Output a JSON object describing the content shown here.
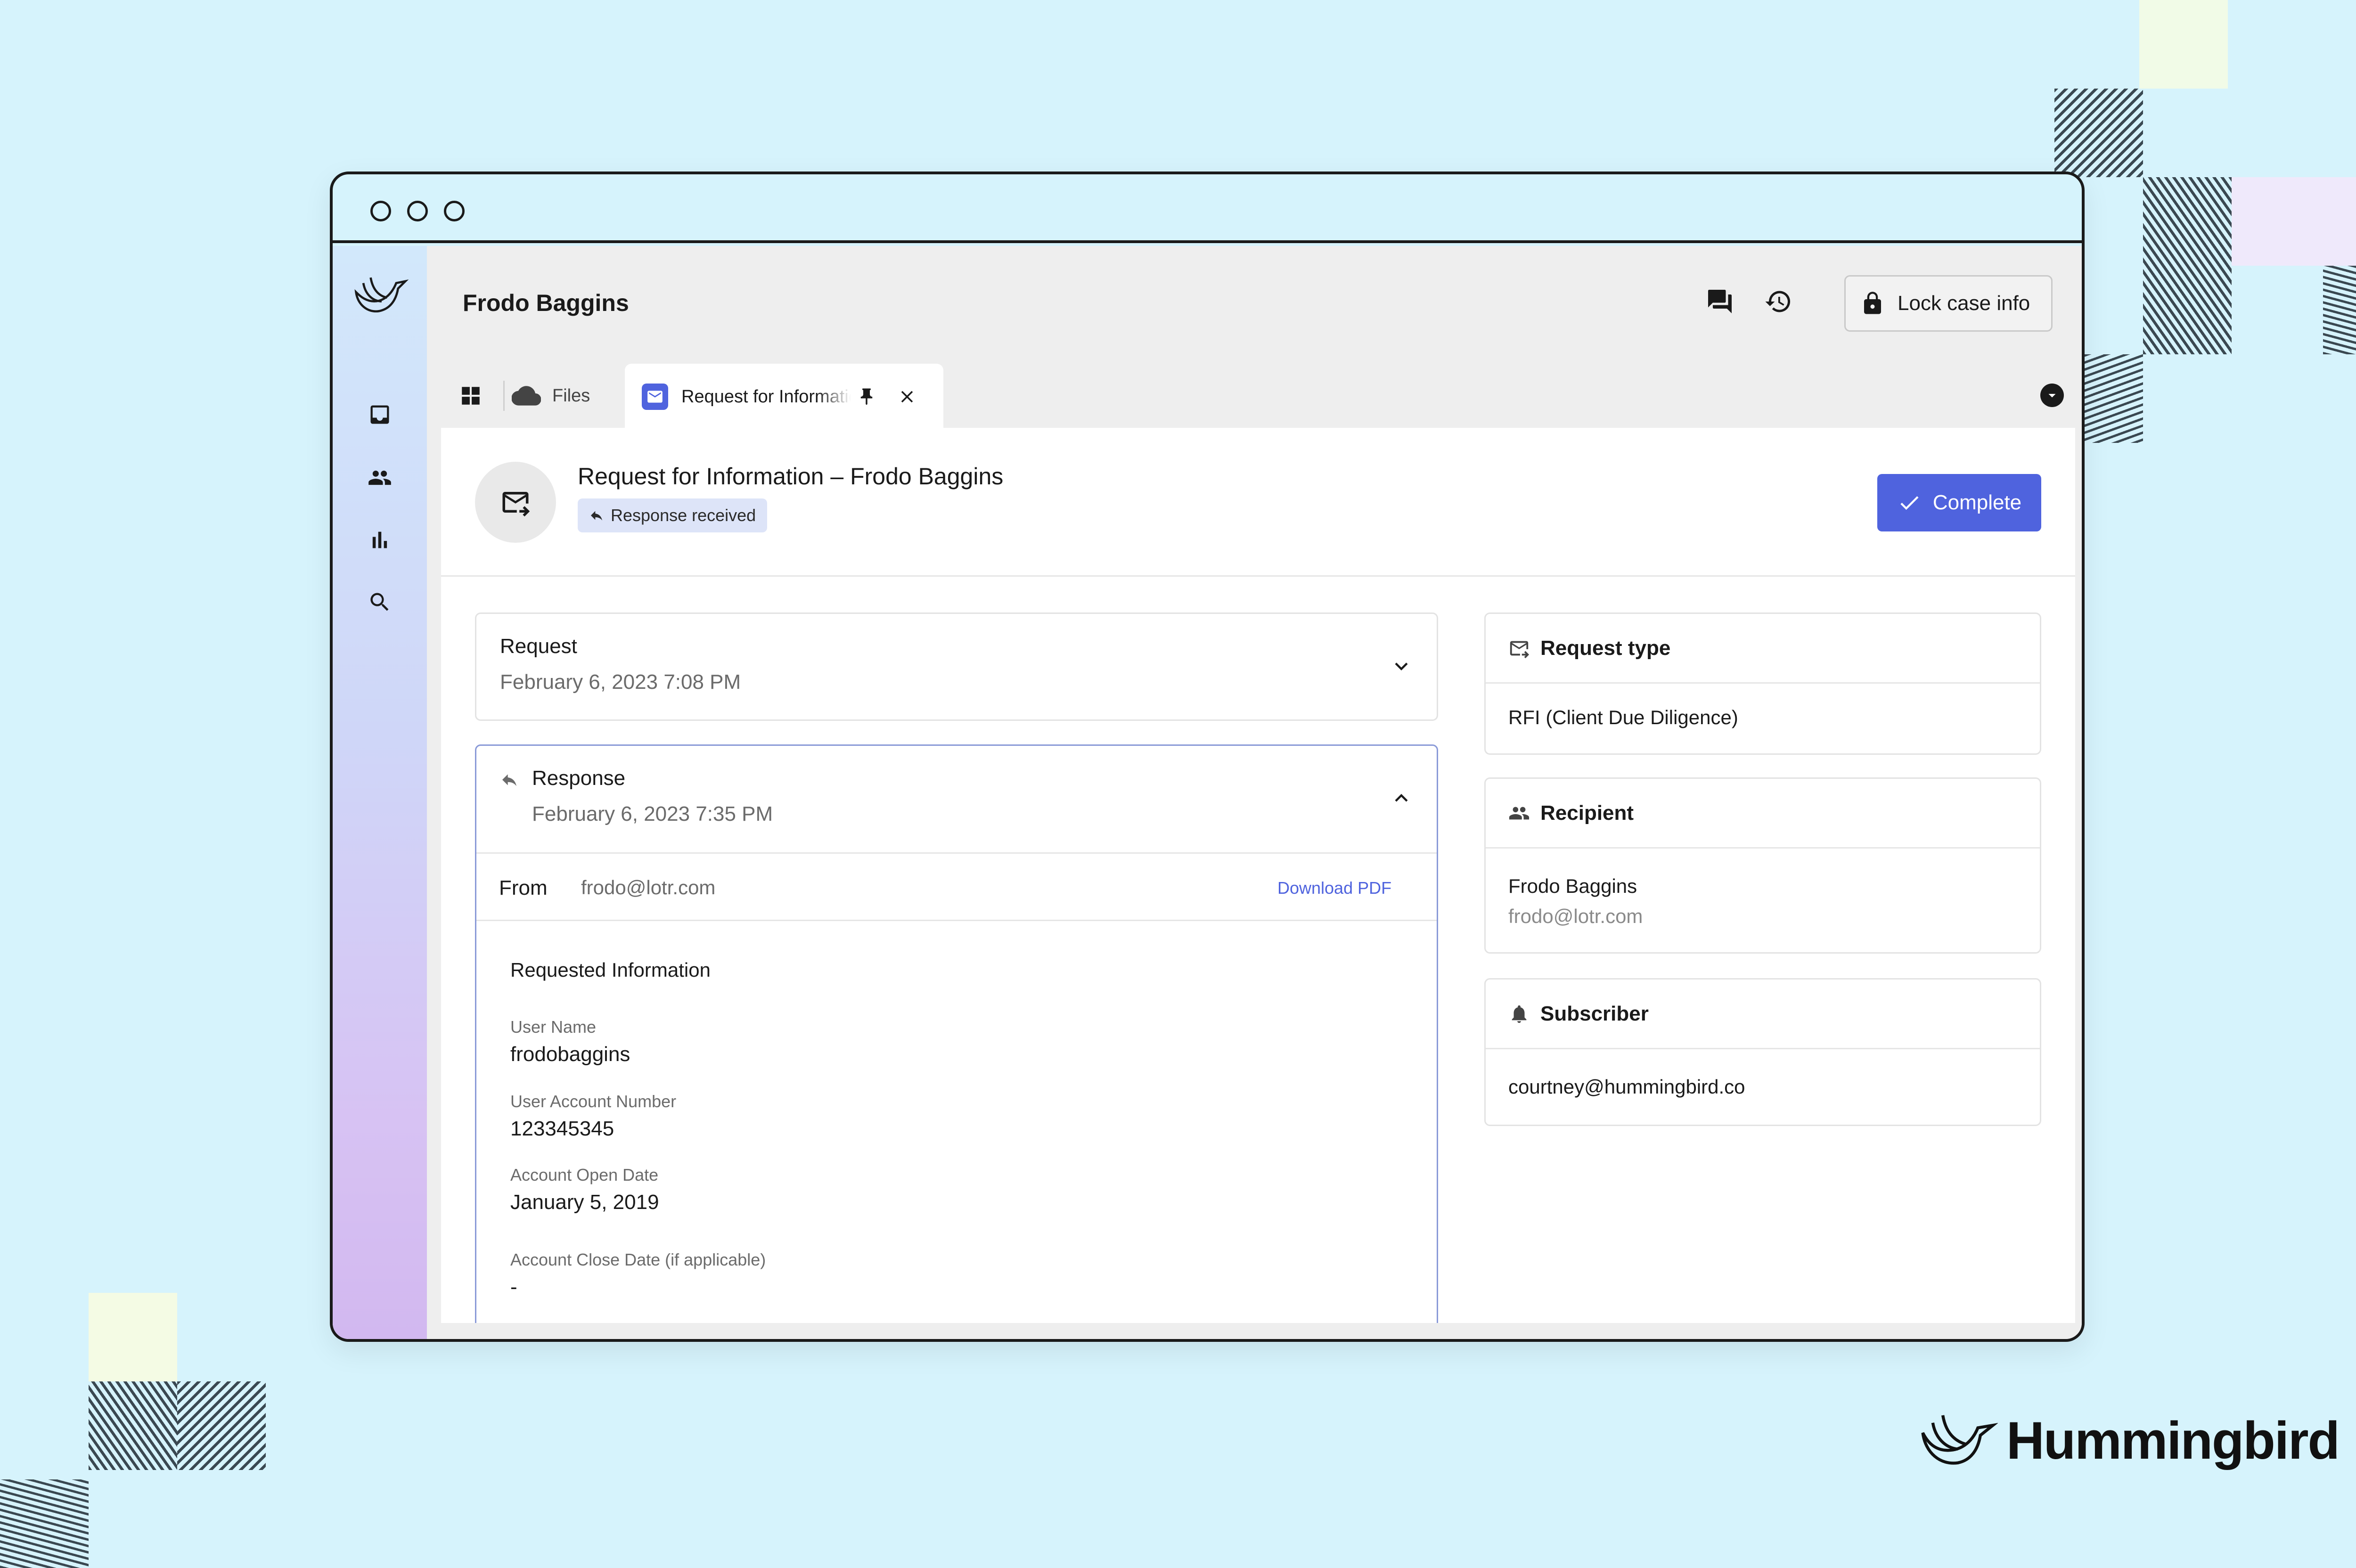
{
  "window": {
    "traffic_lights": [
      "close",
      "minimize",
      "maximize"
    ]
  },
  "sidebar": {
    "logo": "hummingbird-logo",
    "items": [
      {
        "icon": "inbox-icon"
      },
      {
        "icon": "people-icon"
      },
      {
        "icon": "bar-chart-icon"
      },
      {
        "icon": "search-icon"
      }
    ],
    "bottom": [
      {
        "icon": "bell-icon"
      },
      {
        "icon": "avatar"
      }
    ]
  },
  "header": {
    "title": "Frodo Baggins",
    "actions": [
      {
        "icon": "chat-icon"
      },
      {
        "icon": "history-icon"
      }
    ],
    "lock_label": "Lock case info"
  },
  "tabs": {
    "files_label": "Files",
    "active_label": "Request for Information – Frodo Baggins"
  },
  "request": {
    "title": "Request for Information – Frodo Baggins",
    "status_badge": "Response received",
    "complete_label": "Complete",
    "request_card": {
      "title": "Request",
      "date": "February 6, 2023 7:08 PM"
    },
    "response_card": {
      "title": "Response",
      "date": "February 6, 2023 7:35 PM",
      "from_label": "From",
      "from_value": "frodo@lotr.com",
      "download_label": "Download PDF",
      "section_title": "Requested Information",
      "fields": [
        {
          "label": "User Name",
          "value": "frodobaggins"
        },
        {
          "label": "User Account Number",
          "value": "123345345"
        },
        {
          "label": "Account Open Date",
          "value": "January 5, 2019"
        },
        {
          "label": "Account Close Date (if applicable)",
          "value": "-"
        }
      ]
    }
  },
  "details": {
    "request_type": {
      "title": "Request type",
      "value": "RFI (Client Due Diligence)"
    },
    "recipient": {
      "title": "Recipient",
      "name": "Frodo Baggins",
      "email": "frodo@lotr.com"
    },
    "subscriber": {
      "title": "Subscriber",
      "value": "courtney@hummingbird.co"
    }
  },
  "brand": {
    "name": "Hummingbird"
  },
  "colors": {
    "accent": "#4f63de",
    "background": "#d6f3fc",
    "badge_bg": "#dde4f8"
  }
}
